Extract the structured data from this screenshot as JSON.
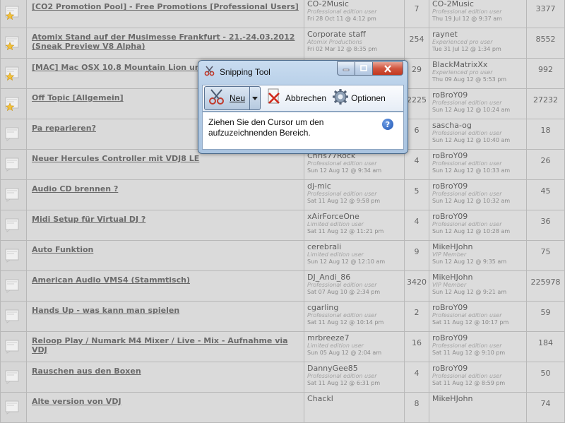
{
  "topics": [
    {
      "icon": "star",
      "title": "[CO2 Promotion Pool] - Free Promotions [Professional Users]",
      "author": {
        "name": "CO-2Music",
        "role": "Professional edition user",
        "date": "Fri 28 Oct 11 @ 4:12 pm"
      },
      "replies": "7",
      "last": {
        "name": "CO-2Music",
        "role": "Professional edition user",
        "date": "Thu 19 Jul 12 @ 9:37 am"
      },
      "views": "3377"
    },
    {
      "icon": "star",
      "title": "Atomix Stand auf der Musimesse Frankfurt - 21.-24.03.2012 (Sneak Preview V8 Alpha)",
      "author": {
        "name": "Corporate staff",
        "role": "Atomix Productions",
        "date": "Fri 02 Mar 12 @ 8:35 pm"
      },
      "replies": "254",
      "last": {
        "name": "raynet",
        "role": "Experienced pro user",
        "date": "Tue 31 Jul 12 @ 1:34 pm"
      },
      "views": "8552"
    },
    {
      "icon": "star",
      "title": "[MAC] Mac OSX 10.8 Mountain Lion und VD",
      "author": {
        "name": "",
        "role": "",
        "date": ""
      },
      "replies": "29",
      "last": {
        "name": "BlackMatrixXx",
        "role": "Experienced pro user",
        "date": "Thu 09 Aug 12 @ 5:53 pm"
      },
      "views": "992"
    },
    {
      "icon": "star",
      "title": "Off Topic [Allgemein]",
      "author": {
        "name": "",
        "role": "",
        "date": ""
      },
      "replies": "2225",
      "last": {
        "name": "roBroY09",
        "role": "Professional edition user",
        "date": "Sun 12 Aug 12 @ 10:24 am"
      },
      "views": "27232"
    },
    {
      "icon": "plain",
      "title": "Pa reparieren?",
      "author": {
        "name": "",
        "role": "",
        "date": ""
      },
      "replies": "6",
      "last": {
        "name": "sascha-og",
        "role": "Professional edition user",
        "date": "Sun 12 Aug 12 @ 10:40 am"
      },
      "views": "18"
    },
    {
      "icon": "plain",
      "title": "Neuer Hercules Controller mit VDJ8 LE",
      "author": {
        "name": "Chris77Rock",
        "role": "Professional edition user",
        "date": "Sun 12 Aug 12 @ 9:34 am"
      },
      "replies": "4",
      "last": {
        "name": "roBroY09",
        "role": "Professional edition user",
        "date": "Sun 12 Aug 12 @ 10:33 am"
      },
      "views": "26"
    },
    {
      "icon": "plain",
      "title": "Audio CD brennen ?",
      "author": {
        "name": "dj-mic",
        "role": "Professional edition user",
        "date": "Sat 11 Aug 12 @ 9:58 pm"
      },
      "replies": "5",
      "last": {
        "name": "roBroY09",
        "role": "Professional edition user",
        "date": "Sun 12 Aug 12 @ 10:32 am"
      },
      "views": "45"
    },
    {
      "icon": "plain",
      "title": "Midi Setup für Virtual DJ ?",
      "author": {
        "name": "xAirForceOne",
        "role": "Limited edition user",
        "date": "Sat 11 Aug 12 @ 11:21 pm"
      },
      "replies": "4",
      "last": {
        "name": "roBroY09",
        "role": "Professional edition user",
        "date": "Sun 12 Aug 12 @ 10:28 am"
      },
      "views": "36"
    },
    {
      "icon": "plain",
      "title": "Auto Funktion",
      "author": {
        "name": "cerebrali",
        "role": "Limited edition user",
        "date": "Sun 12 Aug 12 @ 12:10 am"
      },
      "replies": "9",
      "last": {
        "name": "MikeHJohn",
        "role": "VIP Member",
        "date": "Sun 12 Aug 12 @ 9:35 am"
      },
      "views": "75"
    },
    {
      "icon": "plain",
      "title": "American Audio VMS4 (Stammtisch)",
      "author": {
        "name": "DJ_Andi_86",
        "role": "Professional edition user",
        "date": "Sat 07 Aug 10 @ 2:34 pm"
      },
      "replies": "3420",
      "last": {
        "name": "MikeHJohn",
        "role": "VIP Member",
        "date": "Sun 12 Aug 12 @ 9:21 am"
      },
      "views": "225978"
    },
    {
      "icon": "plain",
      "title": "Hands Up - was kann man spielen",
      "author": {
        "name": "cgarling",
        "role": "Professional edition user",
        "date": "Sat 11 Aug 12 @ 10:14 pm"
      },
      "replies": "2",
      "last": {
        "name": "roBroY09",
        "role": "Professional edition user",
        "date": "Sat 11 Aug 12 @ 10:17 pm"
      },
      "views": "59"
    },
    {
      "icon": "plain",
      "title": "Reloop Play / Numark M4 Mixer / Live - Mix - Aufnahme via VDJ",
      "author": {
        "name": "mrbreeze7",
        "role": "Limited edition user",
        "date": "Sun 05 Aug 12 @ 2:04 am"
      },
      "replies": "16",
      "last": {
        "name": "roBroY09",
        "role": "Professional edition user",
        "date": "Sat 11 Aug 12 @ 9:10 pm"
      },
      "views": "184"
    },
    {
      "icon": "plain",
      "title": "Rauschen aus den Boxen",
      "author": {
        "name": "DannyGee85",
        "role": "Professional edition user",
        "date": "Sat 11 Aug 12 @ 6:31 pm"
      },
      "replies": "4",
      "last": {
        "name": "roBroY09",
        "role": "Professional edition user",
        "date": "Sat 11 Aug 12 @ 8:59 pm"
      },
      "views": "50"
    },
    {
      "icon": "plain",
      "title": "Alte version von VDJ",
      "author": {
        "name": "Chackl",
        "role": "",
        "date": ""
      },
      "replies": "8",
      "last": {
        "name": "MikeHJohn",
        "role": "",
        "date": ""
      },
      "views": "74"
    }
  ],
  "snipping_tool": {
    "title": "Snipping Tool",
    "new_label": "Neu",
    "cancel_label": "Abbrechen",
    "options_label": "Optionen",
    "message": "Ziehen Sie den Cursor um den aufzuzeichnenden Bereich.",
    "colors": {
      "frame": "#b7cfe8",
      "close": "#c2371f"
    }
  }
}
